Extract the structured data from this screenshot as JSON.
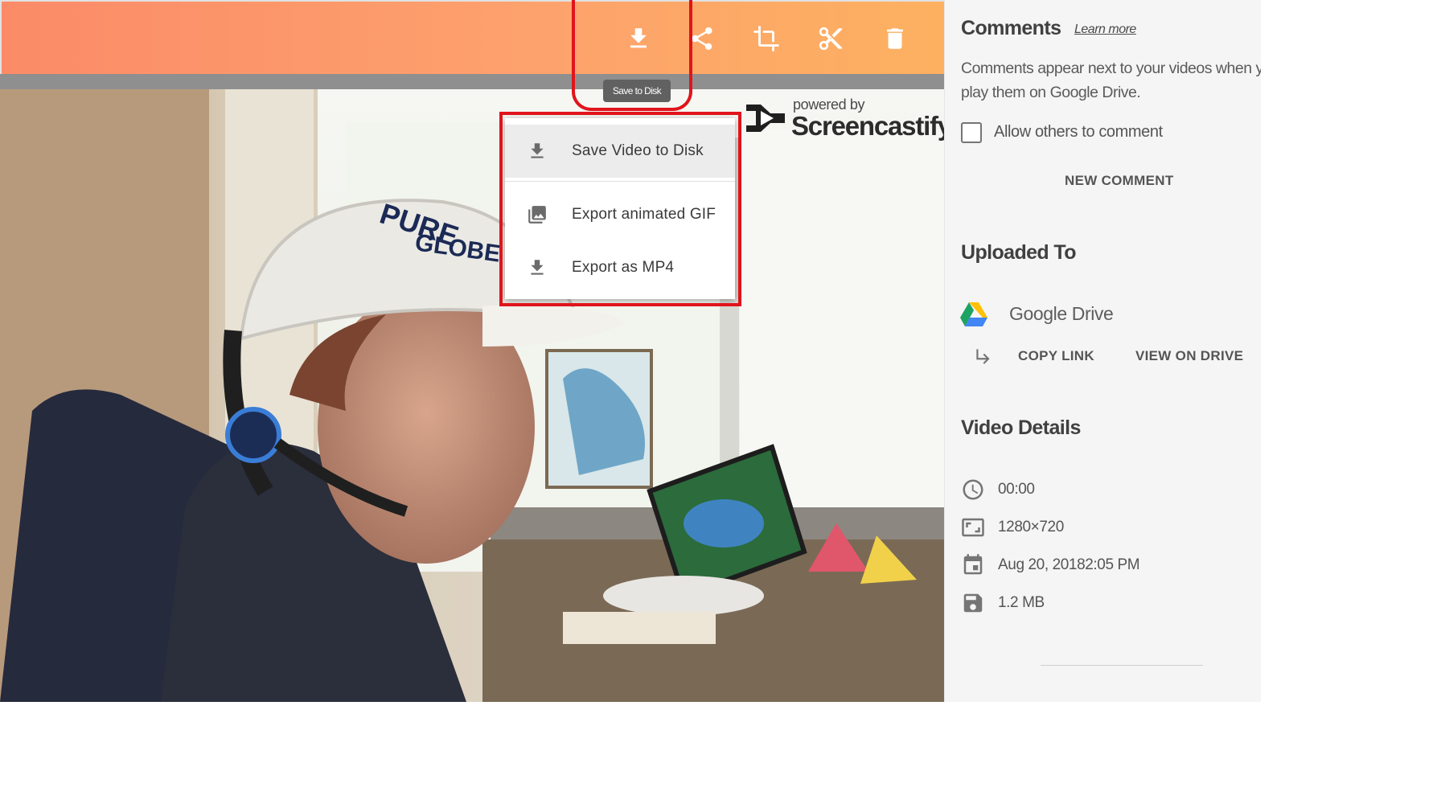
{
  "toolbar": {
    "buttons": [
      {
        "name": "download-icon"
      },
      {
        "name": "share-icon"
      },
      {
        "name": "crop-icon"
      },
      {
        "name": "scissors-icon"
      },
      {
        "name": "trash-icon"
      }
    ],
    "tooltip": "Save to Disk",
    "gradient": [
      "#fb8b68",
      "#fdb160"
    ]
  },
  "watermark": {
    "powered_by": "powered by",
    "brand": "Screencastify"
  },
  "download_menu": {
    "items": [
      {
        "label": "Save Video to Disk",
        "icon": "download-icon"
      },
      {
        "label": "Export animated GIF",
        "icon": "image-icon"
      },
      {
        "label": "Export as MP4",
        "icon": "download-icon"
      }
    ]
  },
  "highlight_color": "#e0141c",
  "comments": {
    "title": "Comments",
    "learn_more": "Learn more",
    "description": "Comments appear next to your videos when you play them on Google Drive.",
    "allow_label": "Allow others to comment",
    "new_comment": "NEW COMMENT"
  },
  "uploaded": {
    "title": "Uploaded To",
    "service": "Google Drive",
    "copy_link": "COPY LINK",
    "view_on_drive": "VIEW ON DRIVE"
  },
  "details": {
    "title": "Video Details",
    "duration": "00:00",
    "resolution": "1280×720",
    "date": "Aug 20, 20182:05 PM",
    "size": "1.2 MB"
  }
}
